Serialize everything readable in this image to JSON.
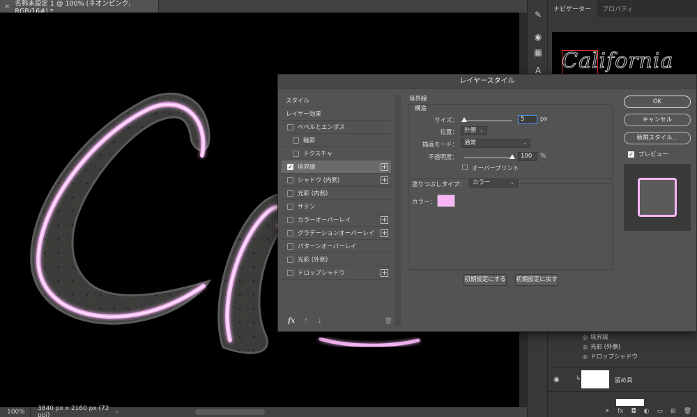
{
  "document": {
    "tab_title": "名称未設定 1 @ 100% (ネオンピンク, RGB/16#) *",
    "zoom": "100%",
    "dimensions": "3840 px x 2160 px (72 ppi)"
  },
  "right_panel": {
    "tabs": [
      {
        "label": "ナビゲーター"
      },
      {
        "label": "プロパティ"
      }
    ],
    "navigator_text": "California",
    "layer_effects": [
      "境界線",
      "光彩 (外側)",
      "ドロップシャドウ"
    ],
    "layer_name": "留め具"
  },
  "dialog": {
    "title": "レイヤースタイル",
    "style_list": {
      "styles_header": "スタイル",
      "effects_header": "レイヤー効果",
      "items": [
        {
          "label": "ベベルとエンボス",
          "checked": false,
          "sub": false,
          "plus": false
        },
        {
          "label": "輪郭",
          "checked": false,
          "sub": true,
          "plus": false
        },
        {
          "label": "テクスチャ",
          "checked": false,
          "sub": true,
          "plus": false
        },
        {
          "label": "境界線",
          "checked": true,
          "sub": false,
          "plus": true,
          "active": true
        },
        {
          "label": "シャドウ (内側)",
          "checked": false,
          "sub": false,
          "plus": true
        },
        {
          "label": "光彩 (内側)",
          "checked": false,
          "sub": false,
          "plus": false
        },
        {
          "label": "サテン",
          "checked": false,
          "sub": false,
          "plus": false
        },
        {
          "label": "カラーオーバーレイ",
          "checked": false,
          "sub": false,
          "plus": true
        },
        {
          "label": "グラデーションオーバーレイ",
          "checked": false,
          "sub": false,
          "plus": true
        },
        {
          "label": "パターンオーバーレイ",
          "checked": false,
          "sub": false,
          "plus": false
        },
        {
          "label": "光彩 (外側)",
          "checked": false,
          "sub": false,
          "plus": false
        },
        {
          "label": "ドロップシャドウ",
          "checked": false,
          "sub": false,
          "plus": true
        }
      ],
      "fx_label": "fx"
    },
    "stroke": {
      "section_title": "境界線",
      "structure_title": "構造",
      "size_label": "サイズ：",
      "size_value": "5",
      "size_unit": "px",
      "position_label": "位置：",
      "position_value": "外側",
      "blend_mode_label": "描画モード：",
      "blend_mode_value": "通常",
      "opacity_label": "不透明度：",
      "opacity_value": "100",
      "opacity_unit": "%",
      "opacity_fraction": 1.0,
      "size_fraction": 0.02,
      "overprint_label": "オーバープリント",
      "fill_type_label": "塗りつぶしタイプ：",
      "fill_type_value": "カラー",
      "color_label": "カラー：",
      "color_value": "#f8b6f7",
      "make_default": "初期設定にする",
      "reset_default": "初期設定に戻す"
    },
    "buttons": {
      "ok": "OK",
      "cancel": "キャンセル",
      "new_style": "新規スタイル...",
      "preview_label": "プレビュー"
    }
  },
  "colors": {
    "neon_pink": "#f8b6f7",
    "neon_glow": "#e79be6",
    "focus_blue": "#4a90e2"
  }
}
